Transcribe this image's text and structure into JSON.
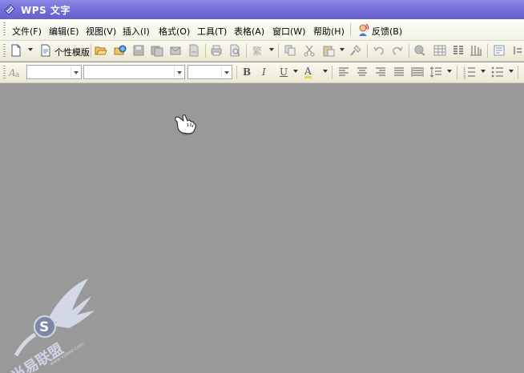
{
  "window": {
    "title": "WPS 文字"
  },
  "menubar": {
    "items": [
      {
        "label": "文件(F)"
      },
      {
        "label": "编辑(E)"
      },
      {
        "label": "视图(V)"
      },
      {
        "label": "插入(I)"
      },
      {
        "label": "格式(O)"
      },
      {
        "label": "工具(T)"
      },
      {
        "label": "表格(A)"
      },
      {
        "label": "窗口(W)"
      },
      {
        "label": "帮助(H)"
      }
    ],
    "feedback_label": "反馈(B)"
  },
  "toolbar": {
    "template_label": "个性模版",
    "font_style_value": "",
    "font_name_value": "",
    "font_size_value": "",
    "bold_label": "B",
    "italic_label": "I",
    "underline_label": "U",
    "font_color_label": "A"
  },
  "watermark": {
    "text": "当易联盟",
    "url": "www.vyeee.com"
  },
  "colors": {
    "title_bar": "#7571d9",
    "menu_bar": "#f7f6ec",
    "workspace": "#999999",
    "watermark": "#d6dcea"
  }
}
